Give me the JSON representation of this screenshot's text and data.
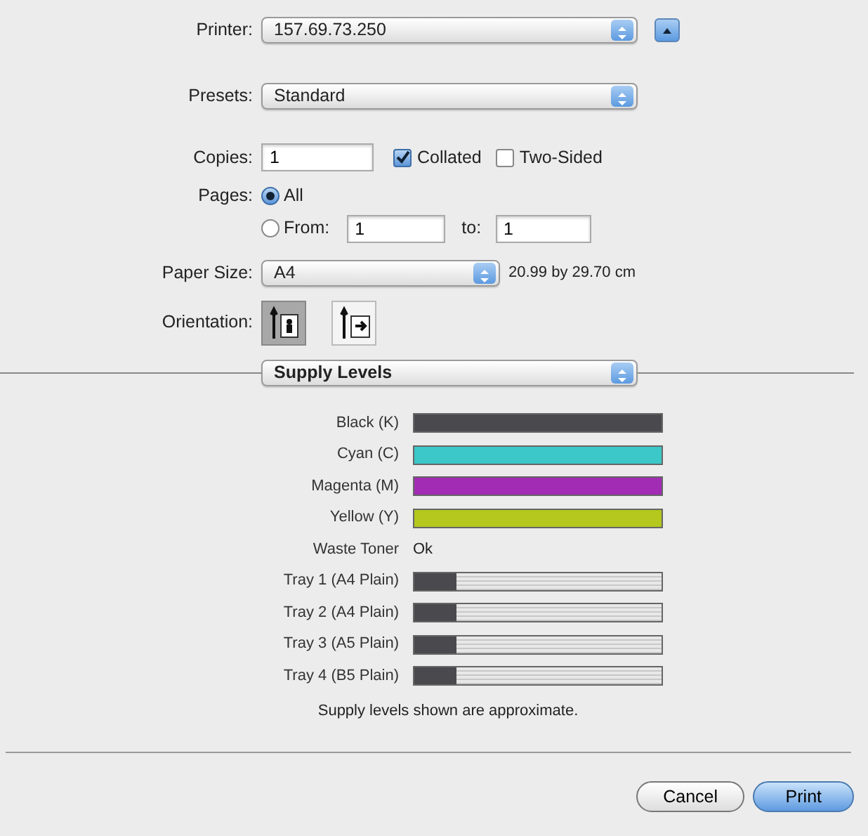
{
  "printer": {
    "label": "Printer:",
    "value": "157.69.73.250"
  },
  "presets": {
    "label": "Presets:",
    "value": "Standard"
  },
  "copies": {
    "label": "Copies:",
    "value": "1",
    "collated": {
      "label": "Collated",
      "checked": true
    },
    "two_sided": {
      "label": "Two-Sided",
      "checked": false
    }
  },
  "pages": {
    "label": "Pages:",
    "options": [
      {
        "label": "All",
        "selected": true,
        "kind": "all"
      },
      {
        "label": "From:",
        "selected": false,
        "kind": "range",
        "from": "1",
        "to_label": "to:",
        "to": "1"
      }
    ]
  },
  "paper_size": {
    "label": "Paper Size:",
    "value": "A4",
    "dimensions": "20.99 by 29.70 cm"
  },
  "orientation": {
    "label": "Orientation:",
    "options": [
      {
        "kind": "portrait",
        "selected": true
      },
      {
        "kind": "landscape",
        "selected": false
      }
    ]
  },
  "panel": {
    "value": "Supply Levels"
  },
  "supplies": [
    {
      "label": "Black (K)",
      "kind": "bar",
      "level": 1,
      "color": "#4a4a4e"
    },
    {
      "label": "Cyan (C)",
      "kind": "bar",
      "level": 1,
      "color": "#3cc8c8"
    },
    {
      "label": "Magenta (M)",
      "kind": "bar",
      "level": 1,
      "color": "#a22cb4"
    },
    {
      "label": "Yellow (Y)",
      "kind": "bar",
      "level": 1,
      "color": "#b4c81e"
    },
    {
      "label": "Waste Toner",
      "kind": "status",
      "status": "Ok"
    },
    {
      "label": "Tray 1 (A4 Plain)",
      "kind": "bar",
      "level": 0.17,
      "color": "#4a4a4e"
    },
    {
      "label": "Tray 2 (A4 Plain)",
      "kind": "bar",
      "level": 0.17,
      "color": "#4a4a4e"
    },
    {
      "label": "Tray 3 (A5 Plain)",
      "kind": "bar",
      "level": 0.17,
      "color": "#4a4a4e"
    },
    {
      "label": "Tray 4 (B5 Plain)",
      "kind": "bar",
      "level": 0.17,
      "color": "#4a4a4e"
    }
  ],
  "note": "Supply levels shown are approximate.",
  "buttons": [
    {
      "label": "Cancel",
      "kind": "secondary"
    },
    {
      "label": "Print",
      "kind": "default"
    }
  ]
}
